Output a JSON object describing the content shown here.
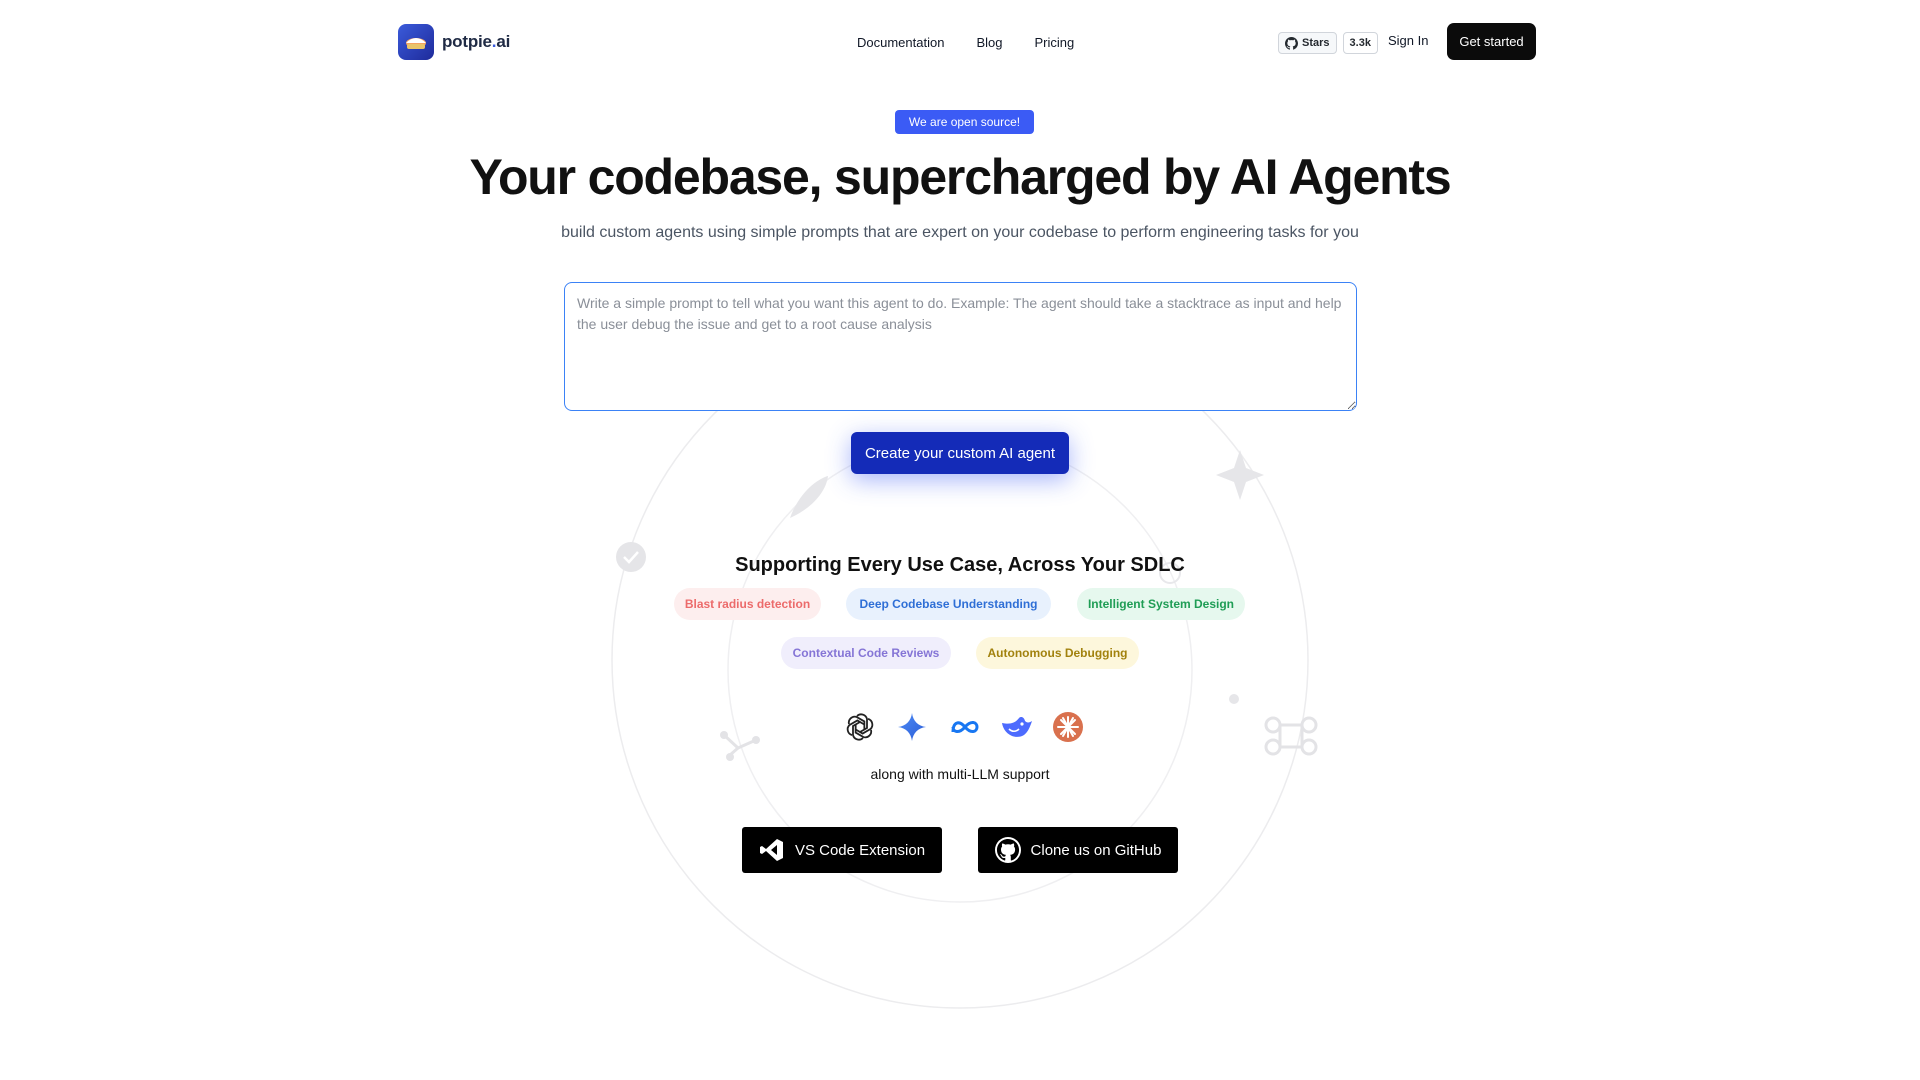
{
  "header": {
    "brand": {
      "name": "potpie",
      "dot": ".",
      "suffix": "ai"
    },
    "nav": [
      "Documentation",
      "Blog",
      "Pricing"
    ],
    "github": {
      "stars_label": "Stars",
      "stars_count": "3.3k"
    },
    "sign_in": "Sign In",
    "get_started": "Get started"
  },
  "hero": {
    "badge": "We are open source!",
    "title": "Your codebase, supercharged by AI Agents",
    "subtitle": "build custom agents using simple prompts that are expert on your codebase to perform engineering tasks for you",
    "prompt_placeholder": "Write a simple prompt to tell what you want this agent to do. Example: The agent should take a stacktrace as input and help the user debug the issue and get to a root cause analysis",
    "cta": "Create your custom AI agent"
  },
  "use_cases": {
    "title": "Supporting Every Use Case, Across Your SDLC",
    "pills": [
      {
        "label": "Blast radius detection",
        "color": "#ec6b6b"
      },
      {
        "label": "Deep Codebase Understanding",
        "color": "#2f6fd6"
      },
      {
        "label": "Intelligent System Design",
        "color": "#1f9d55"
      },
      {
        "label": "Contextual Code Reviews",
        "color": "#8575d6"
      },
      {
        "label": "Autonomous Debugging",
        "color": "#a2820e"
      }
    ]
  },
  "llm": {
    "icons": [
      "openai-icon",
      "gemini-icon",
      "meta-icon",
      "deepseek-icon",
      "claude-icon"
    ],
    "caption": "along with multi-LLM support"
  },
  "buttons": {
    "vscode": "VS Code Extension",
    "github": "Clone us on GitHub"
  },
  "colors": {
    "accent": "#3b5bf5",
    "cta": "#142bb8",
    "dark": "#000000"
  }
}
